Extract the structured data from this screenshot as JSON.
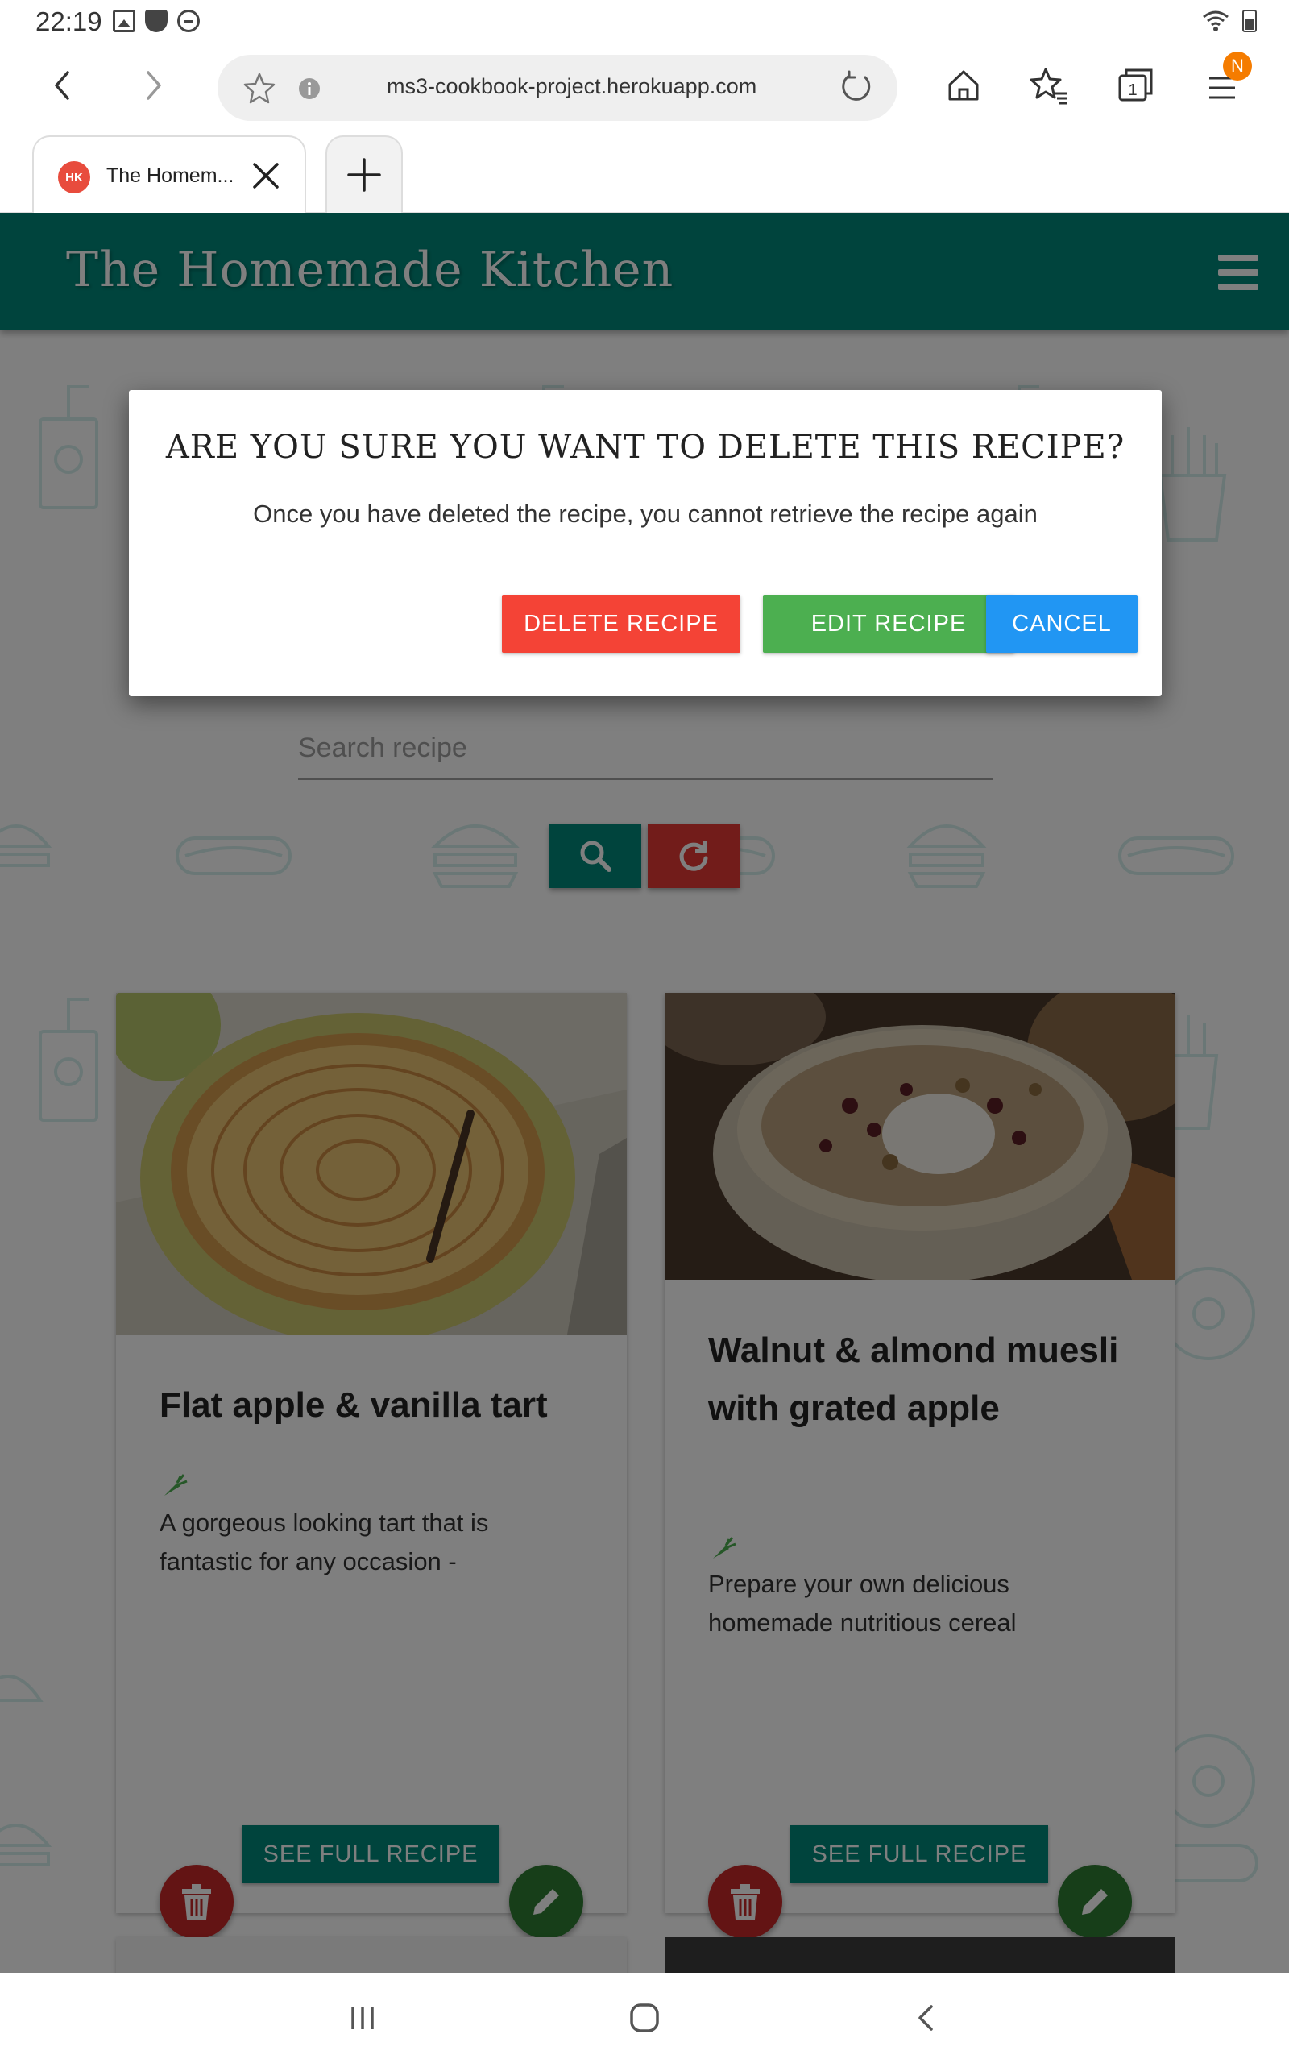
{
  "status_bar": {
    "time": "22:19",
    "icons": [
      "image-icon",
      "shield-icon",
      "do-not-disturb-icon",
      "wifi-icon",
      "battery-icon"
    ]
  },
  "browser": {
    "url": "ms3-cookbook-project.herokuapp.com",
    "tab_title": "The Homem...",
    "tab_favicon_text": "HK",
    "tabs_count": "1",
    "menu_badge": "N"
  },
  "site": {
    "title": "The Homemade Kitchen"
  },
  "search": {
    "placeholder": "Search recipe"
  },
  "modal": {
    "title": "ARE YOU SURE YOU WANT TO DELETE THIS RECIPE?",
    "text": "Once you have deleted the recipe, you cannot retrieve the recipe again",
    "delete_label": "DELETE RECIPE",
    "edit_label": "EDIT RECIPE",
    "cancel_label": "CANCEL"
  },
  "recipes": [
    {
      "title": "Flat apple & vanilla tart",
      "description": "A gorgeous looking tart that is fantastic for any occasion -",
      "button_label": "SEE FULL RECIPE"
    },
    {
      "title": "Walnut & almond muesli with grated apple",
      "description": "Prepare your own delicious homemade nutritious cereal",
      "button_label": "SEE FULL RECIPE"
    }
  ],
  "colors": {
    "brand_teal": "#00897b",
    "delete_red": "#f44336",
    "edit_green": "#4caf50",
    "cancel_blue": "#2196f3",
    "reset_red": "#e53935",
    "fab_red": "#c62828",
    "fab_green": "#2e7d32",
    "menu_badge": "#f57c00"
  }
}
